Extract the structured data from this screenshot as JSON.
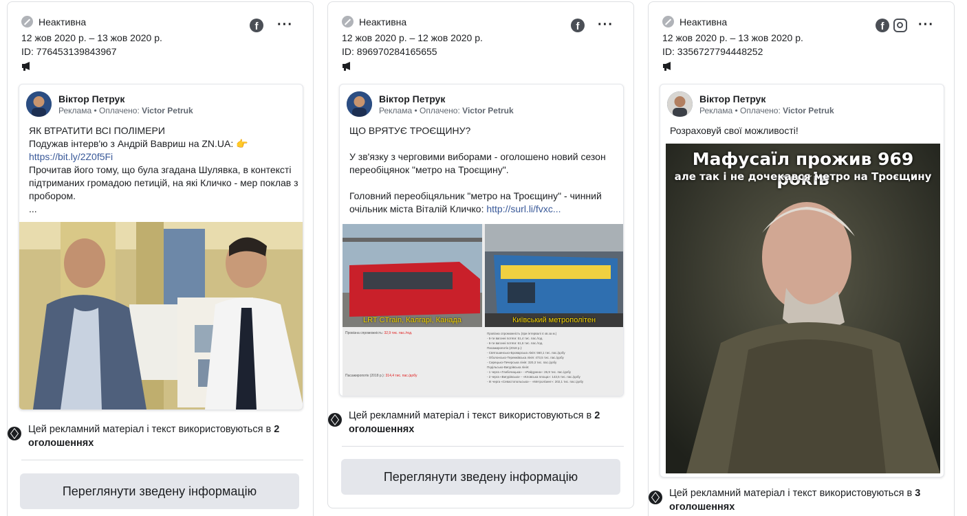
{
  "cards": [
    {
      "status": "Неактивна",
      "dates": "12 жов 2020 р. – 13 жов 2020 р.",
      "id": "ID: 776453139843967",
      "advertiser": "Віктор Петрук",
      "sponsored_label": "Реклама • Оплачено:",
      "paid_by": "Victor Petruk",
      "text": {
        "l1": "ЯК ВТРАТИТИ ВСІ ПОЛІМЕРИ",
        "l2": "Подужав інтерв'ю з Андрій Вавриш на ZN.UA:",
        "link": "https://bit.ly/2Z0f5Fi",
        "l3": "Прочитав його тому, що була згадана Шулявка, в контексті підтриманих громадою петицій, на які Кличко - мер поклав з пробором.",
        "ellipsis": "..."
      },
      "usage_prefix": "Цей рекламний матеріал і текст використовуються в",
      "usage_count": "2 оголошеннях",
      "button": "Переглянути зведену інформацію"
    },
    {
      "status": "Неактивна",
      "dates": "12 жов 2020 р. – 12 жов 2020 р.",
      "id": "ID: 896970284165655",
      "advertiser": "Віктор Петрук",
      "sponsored_label": "Реклама • Оплачено:",
      "paid_by": "Victor Petruk",
      "text": {
        "l1": "ЩО ВРЯТУЄ ТРОЄЩИНУ?",
        "l2": "У зв'язку з черговими виборами - оголошено новий сезон переобіцянок \"метро на Троєщину\".",
        "l3": "Головний переобіцяльник \"метро на Троєщину\" - чинний очільник міста Віталій Кличко:",
        "link": "http://surl.li/fvxc..."
      },
      "image": {
        "left_caption": "LRT CTrain, Калгарі, Канада",
        "right_caption": "Київський метрополітен",
        "left_stat": "Провізна спроможність:",
        "left_stat_val": "32,9 тис. пас./год.",
        "left_stat2": "Пасажиропотік (2018 р.):",
        "left_stat2_val": "314,4 тис. пас./добу",
        "right_stat": "Провізна спроможність (при інтервалі 4 хв.за м.)",
        "right_lines": [
          "- 5-ти вагонні потяги: 51,4 тис. пас./год.",
          "- 6-ти вагонні потяги: 61,6 тис. пас./год.",
          "Пасажиропотік (2018 р.):",
          "- Святошинсько-Броварська лінія: 560,1 тис. пас./добу",
          "- Оболонсько-Теремківська лінія: 473,5 тис. пас./добу",
          "- Сирецько-Печерська лінія: 320,3 тис. пас./добу",
          "Подільсько-Вигурівська лінія:",
          "- 1 черга «Глибочицька» - «Райдужна»: 26,9 тис. пас./добу",
          "- 2 черга «Вигурівська» - «Кловська площа»: 143,5 тис. пас./добу",
          "- III черга «Севастопольська» - «Метролізинг»: 202,1 тис. пас./добу"
        ]
      },
      "usage_prefix": "Цей рекламний матеріал і текст використовуються в",
      "usage_count": "2 оголошеннях",
      "button": "Переглянути зведену інформацію"
    },
    {
      "status": "Неактивна",
      "dates": "12 жов 2020 р. – 13 жов 2020 р.",
      "id": "ID: 3356727794448252",
      "advertiser": "Віктор Петрук",
      "sponsored_label": "Реклама • Оплачено:",
      "paid_by": "Victor Petruk",
      "text": {
        "l1": "Розраховуй свої можливості!"
      },
      "image": {
        "headline": "Мафусаїл прожив 969 років",
        "subline": "але так і не дочекався метро на Троєщину"
      },
      "usage_prefix": "Цей рекламний матеріал і текст використовуються в",
      "usage_count": "3 оголошеннях"
    }
  ],
  "icons": {
    "status": "inactive-icon",
    "megaphone": "megaphone-icon",
    "facebook": "facebook-icon",
    "instagram": "instagram-icon",
    "more": "more-options-icon",
    "layers": "layers-icon"
  },
  "colors": {
    "link": "#385898",
    "button_bg": "#e4e6eb",
    "caption_yellow": "#f5d400",
    "stat_red": "#e01b1b"
  }
}
